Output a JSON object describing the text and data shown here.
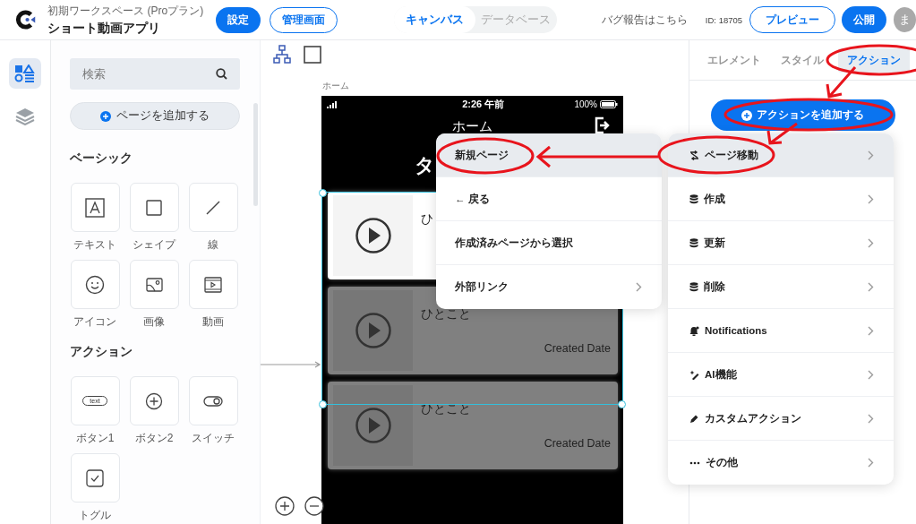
{
  "header": {
    "workspace": "初期ワークスペース (Proプラン)",
    "app_name": "ショート動画アプリ",
    "settings": "設定",
    "admin": "管理画面",
    "view_tabs": [
      {
        "label": "キャンバス",
        "selected": true
      },
      {
        "label": "データベース",
        "selected": false
      }
    ],
    "bug_report": "バグ報告はこちら",
    "id": "ID: 18705",
    "preview": "プレビュー",
    "publish": "公開",
    "avatar": "ま"
  },
  "rail": [
    {
      "kind": "elements",
      "selected": true
    },
    {
      "kind": "layers",
      "selected": false
    }
  ],
  "panel": {
    "search_placeholder": "検索",
    "add_page": "ページを追加する",
    "sections": [
      {
        "title": "ベーシック",
        "items": [
          {
            "kind": "text",
            "label": "テキスト"
          },
          {
            "kind": "shape",
            "label": "シェイプ"
          },
          {
            "kind": "line",
            "label": "線"
          },
          {
            "kind": "icon",
            "label": "アイコン"
          },
          {
            "kind": "image",
            "label": "画像"
          },
          {
            "kind": "video",
            "label": "動画"
          }
        ]
      },
      {
        "title": "アクション",
        "items": [
          {
            "kind": "button1",
            "label": "ボタン1",
            "glyph": "text"
          },
          {
            "kind": "button2",
            "label": "ボタン2"
          },
          {
            "kind": "switch",
            "label": "スイッチ"
          },
          {
            "kind": "toggle",
            "label": "トグル"
          }
        ]
      }
    ]
  },
  "canvas": {
    "page_label": "ホーム",
    "phone": {
      "time": "2:26 午前",
      "battery": "100%",
      "title": "ホーム",
      "heading": "タ",
      "cards": [
        {
          "selected": true,
          "caption": "ひ"
        },
        {
          "selected": false,
          "caption": "ひとこと",
          "date": "Created Date"
        },
        {
          "selected": false,
          "caption": "ひとこと",
          "date": "Created Date"
        }
      ]
    }
  },
  "inspector": {
    "tabs": [
      {
        "label": "エレメント",
        "selected": false
      },
      {
        "label": "スタイル",
        "selected": false
      },
      {
        "label": "アクション",
        "selected": true
      }
    ],
    "add_action": "アクションを追加する"
  },
  "action_menu": [
    {
      "kind": "transition",
      "label": "ページ移動",
      "selected": true
    },
    {
      "kind": "database",
      "label": "作成",
      "selected": false
    },
    {
      "kind": "database",
      "label": "更新",
      "selected": false
    },
    {
      "kind": "database",
      "label": "削除",
      "selected": false
    },
    {
      "kind": "bell",
      "label": "Notifications",
      "selected": false
    },
    {
      "kind": "sparkle",
      "label": "AI機能",
      "selected": false
    },
    {
      "kind": "pen",
      "label": "カスタムアクション",
      "selected": false
    },
    {
      "kind": "dots",
      "label": "その他",
      "selected": false
    }
  ],
  "submenu": [
    {
      "label": "新規ページ",
      "selected": true,
      "has_submenu": false
    },
    {
      "label": "← 戻る",
      "selected": false,
      "has_submenu": false
    },
    {
      "label": "作成済みページから選択",
      "selected": false,
      "has_submenu": false
    },
    {
      "label": "外部リンク",
      "selected": false,
      "has_submenu": true
    }
  ]
}
